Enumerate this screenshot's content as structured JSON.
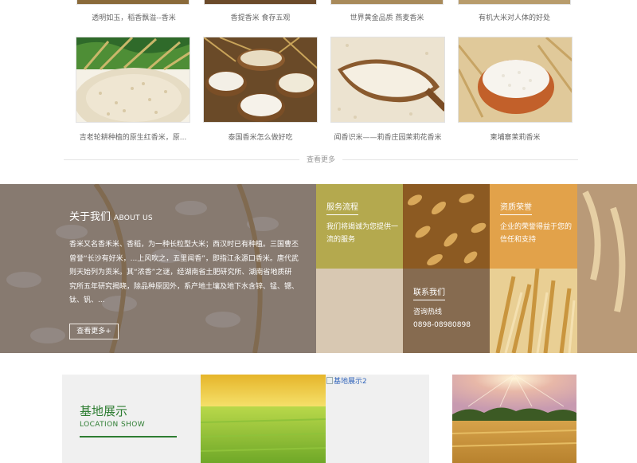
{
  "top_products": [
    {
      "caption": "透明如玉，稻香飘溢--香米"
    },
    {
      "caption": "香提香米 食存五观"
    },
    {
      "caption": "世界黄金品质 燕麦香米"
    },
    {
      "caption": "有机大米对人体的好处"
    }
  ],
  "products": [
    {
      "caption": "吉老轮耕种植的原生红香米，原...",
      "icon": "rice-grains-with-wheat-photo"
    },
    {
      "caption": "泰国香米怎么做好吃",
      "icon": "rice-bowls-photo"
    },
    {
      "caption": "闻香识米——莉香庄园茉莉花香米",
      "icon": "rice-spoon-photo"
    },
    {
      "caption": "柬埔寨茉莉香米",
      "icon": "rice-bowl-photo"
    }
  ],
  "more_link": "查看更多",
  "about": {
    "title": "关于我们",
    "title_en": "ABOUT US",
    "text": "香米又名香禾米、香稻，为一种长粒型大米；西汉时已有种植。三国曹丕曾誉“长沙有好米，...上风吹之，五里闻香”，即指江永源口香米。唐代武则天始列为贡米。其“浓香”之谜，经湖南省土肥研究所、湖南省地质研究所五年研究揭晓，除品种原因外，系产地土壤及地下水含锌、锰、锶、钛、钒、...",
    "more_button": "查看更多+"
  },
  "tiles": {
    "service": {
      "title": "服务流程",
      "text": "我们将竭诚为您提供一流的服务"
    },
    "honor": {
      "title": "资质荣誉",
      "text": "企业的荣誉得益于您的信任和支持"
    },
    "contact": {
      "title": "联系我们",
      "hotline_label": "咨询热线",
      "hotline": "0898-08980898"
    }
  },
  "base": {
    "title": "基地展示",
    "title_en": "LOCATION SHOW",
    "broken_image_alt": "基地展示2"
  },
  "colors": {
    "service_tile": "#b4a94e",
    "honor_tile": "#e2a24a",
    "base_green": "#2e7d32",
    "about_overlay": "#463a3a"
  }
}
